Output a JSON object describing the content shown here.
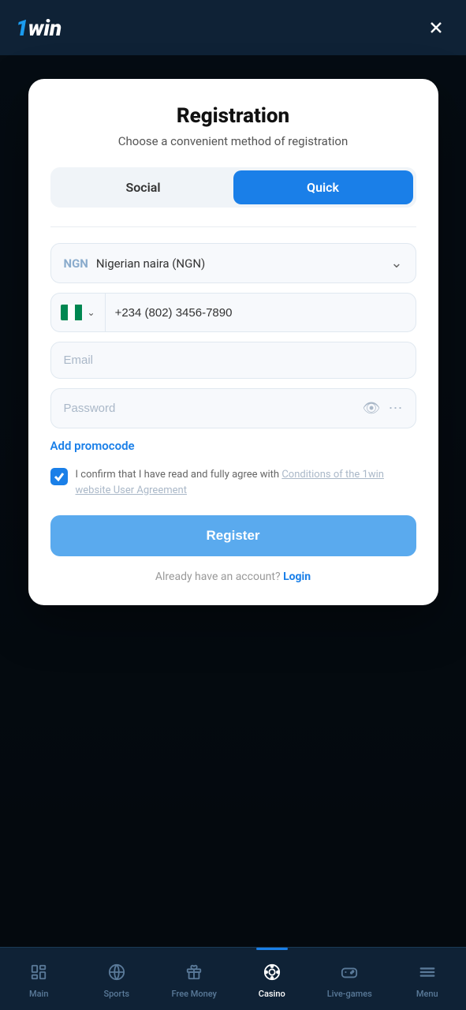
{
  "header": {
    "logo": "1win",
    "close_label": "Close"
  },
  "modal": {
    "title": "Registration",
    "subtitle": "Choose a convenient method of registration",
    "tabs": [
      {
        "id": "social",
        "label": "Social",
        "active": false
      },
      {
        "id": "quick",
        "label": "Quick",
        "active": true
      }
    ],
    "currency_code": "NGN",
    "currency_label": "Nigerian naira (NGN)",
    "phone_country_code": "+234",
    "phone_placeholder": "(802) 3456-7890",
    "email_placeholder": "Email",
    "password_placeholder": "Password",
    "promo_label": "Add promocode",
    "checkbox_text": "I confirm that I have read and fully agree with ",
    "checkbox_link_text": "Conditions of the 1win website User Agreement",
    "register_label": "Register",
    "already_account_text": "Already have an account?",
    "login_label": "Login"
  },
  "bottom_nav": {
    "items": [
      {
        "id": "main",
        "label": "Main",
        "icon": "main"
      },
      {
        "id": "sports",
        "label": "Sports",
        "icon": "sports"
      },
      {
        "id": "free-money",
        "label": "Free Money",
        "icon": "gift"
      },
      {
        "id": "casino",
        "label": "Casino",
        "icon": "casino",
        "active": true
      },
      {
        "id": "live-games",
        "label": "Live-games",
        "icon": "gamepad"
      },
      {
        "id": "menu",
        "label": "Menu",
        "icon": "menu"
      }
    ]
  }
}
